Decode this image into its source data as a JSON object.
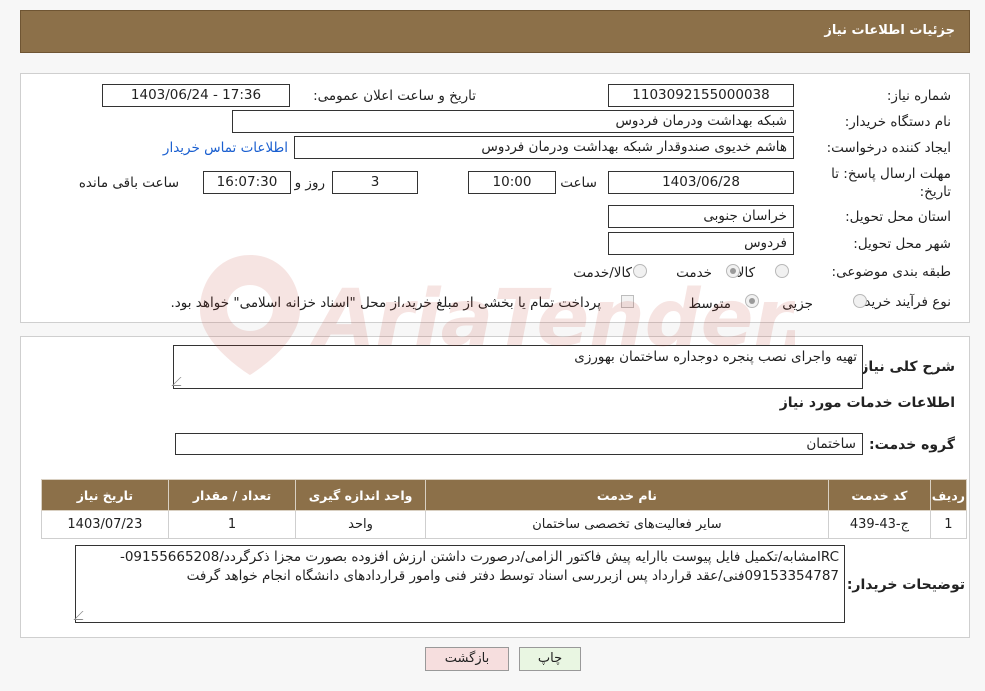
{
  "page_title": "جزئیات اطلاعات نیاز",
  "need_info": {
    "need_number_label": "شماره نیاز:",
    "need_number": "1103092155000038",
    "announce_label": "تاریخ و ساعت اعلان عمومی:",
    "announce_value": "1403/06/24 - 17:36",
    "buyer_org_label": "نام دستگاه خریدار:",
    "buyer_org": "شبکه بهداشت ودرمان فردوس",
    "creator_label": "ایجاد کننده درخواست:",
    "creator": "هاشم خدیوی صندوقدار شبکه بهداشت ودرمان فردوس",
    "contact_link": "اطلاعات تماس خریدار",
    "deadline_label_line1": "مهلت ارسال پاسخ: تا",
    "deadline_label_line2": "تاریخ:",
    "deadline_date": "1403/06/28",
    "time_label": "ساعت",
    "deadline_time": "10:00",
    "days_value": "3",
    "days_label": "روز و",
    "remaining_time": "16:07:30",
    "remaining_label": "ساعت باقی مانده",
    "province_label": "استان محل تحویل:",
    "province": "خراسان جنوبی",
    "city_label": "شهر محل تحویل:",
    "city": "فردوس",
    "category_label": "طبقه بندی موضوعی:",
    "category_options": [
      "کالا",
      "خدمت",
      "کالا/خدمت"
    ],
    "process_label": "نوع فرآیند خرید :",
    "process_options": [
      "جزیی",
      "متوسط"
    ],
    "payment_note": "پرداخت تمام یا بخشی از مبلغ خرید،از محل \"اسناد خزانه اسلامی\" خواهد بود."
  },
  "details": {
    "summary_label": "شرح کلی نیاز:",
    "summary": "تهیه واجرای نصب پنجره دوجداره ساختمان بهورزی",
    "services_title": "اطلاعات خدمات مورد نیاز",
    "service_group_label": "گروه خدمت:",
    "service_group": "ساختمان",
    "table_headers": [
      "ردیف",
      "کد خدمت",
      "نام خدمت",
      "واحد اندازه گیری",
      "تعداد / مقدار",
      "تاریخ نیاز"
    ],
    "table_rows": [
      [
        "1",
        "ج-43-439",
        "سایر فعالیت‌های تخصصی ساختمان",
        "واحد",
        "1",
        "1403/07/23"
      ]
    ],
    "buyer_notes_label": "توضیحات خریدار:",
    "buyer_notes": "IRCمشابه/تکمیل فایل پیوست باارایه پیش فاکتور الزامی/درصورت داشتن ارزش افزوده بصورت مجزا ذکرگردد/09155665208-09153354787فنی/عقد قرارداد پس ازبررسی اسناد توسط دفتر فنی وامور قراردادهای دانشگاه انجام خواهد گرفت"
  },
  "buttons": {
    "print": "چاپ",
    "back": "بازگشت"
  },
  "watermark": "AriaTender.neT",
  "colors": {
    "header_brown": "#8c7049",
    "link_blue": "#1a5fd0",
    "print_btn": "#e9f6e2",
    "back_btn": "#f6dede"
  }
}
